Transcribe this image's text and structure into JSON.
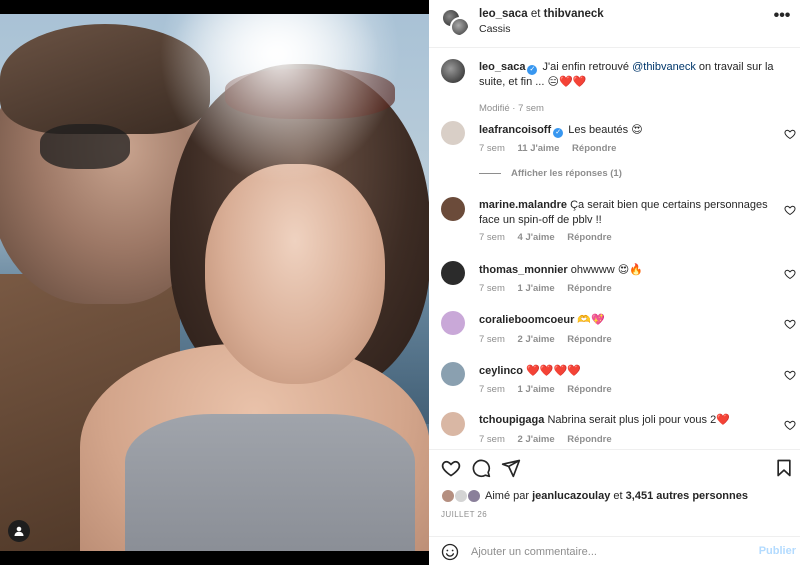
{
  "header": {
    "user1": "leo_saca",
    "and": "et",
    "user2": "thibvaneck",
    "location": "Cassis",
    "more": "•••"
  },
  "caption": {
    "user": "leo_saca",
    "verified": true,
    "text_before": "J'ai enfin retrouvé",
    "mention": "@thibvaneck",
    "text_after": "on travail sur la suite, et fin ... 😑❤️❤️",
    "meta": "Modifié · 7 sem"
  },
  "comments": [
    {
      "user": "leafrancoisoff",
      "verified": true,
      "text": "Les beautés 😍",
      "time": "7 sem",
      "likes": "11 J'aime",
      "reply": "Répondre",
      "avatar_color": "#d9cfc7"
    },
    {
      "user": "marine.malandre",
      "verified": false,
      "text": "Ça serait bien que certains personnages face un spin-off de pblv !!",
      "time": "7 sem",
      "likes": "4 J'aime",
      "reply": "Répondre",
      "avatar_color": "#6b4b3a"
    },
    {
      "user": "thomas_monnier",
      "verified": false,
      "text": "ohwwww 😍🔥",
      "time": "7 sem",
      "likes": "1 J'aime",
      "reply": "Répondre",
      "avatar_color": "#2b2b2b"
    },
    {
      "user": "coralieboomcoeur",
      "verified": false,
      "text": "🫶💖",
      "time": "7 sem",
      "likes": "2 J'aime",
      "reply": "Répondre",
      "avatar_color": "#c9a8d8"
    },
    {
      "user": "ceylinco",
      "verified": false,
      "text": "❤️❤️❤️❤️",
      "time": "7 sem",
      "likes": "1 J'aime",
      "reply": "Répondre",
      "avatar_color": "#8aa0b0"
    },
    {
      "user": "tchoupigaga",
      "verified": false,
      "text": "Nabrina serait plus joli pour vous 2❤️",
      "time": "7 sem",
      "likes": "2 J'aime",
      "reply": "Répondre",
      "avatar_color": "#d9b7a4"
    }
  ],
  "view_replies": "Afficher les réponses (1)",
  "likes_summary": {
    "prefix": "Aimé par",
    "user": "jeanlucazoulay",
    "middle": "et",
    "count": "3,451 autres personnes"
  },
  "date": "JUILLET 26",
  "comment_box": {
    "placeholder": "Ajouter un commentaire...",
    "publish": "Publier"
  },
  "colors": {
    "accent": "#0095f6",
    "verified": "#3897f0",
    "muted": "#8e8e8e",
    "publish_disabled": "#b3dbff"
  }
}
